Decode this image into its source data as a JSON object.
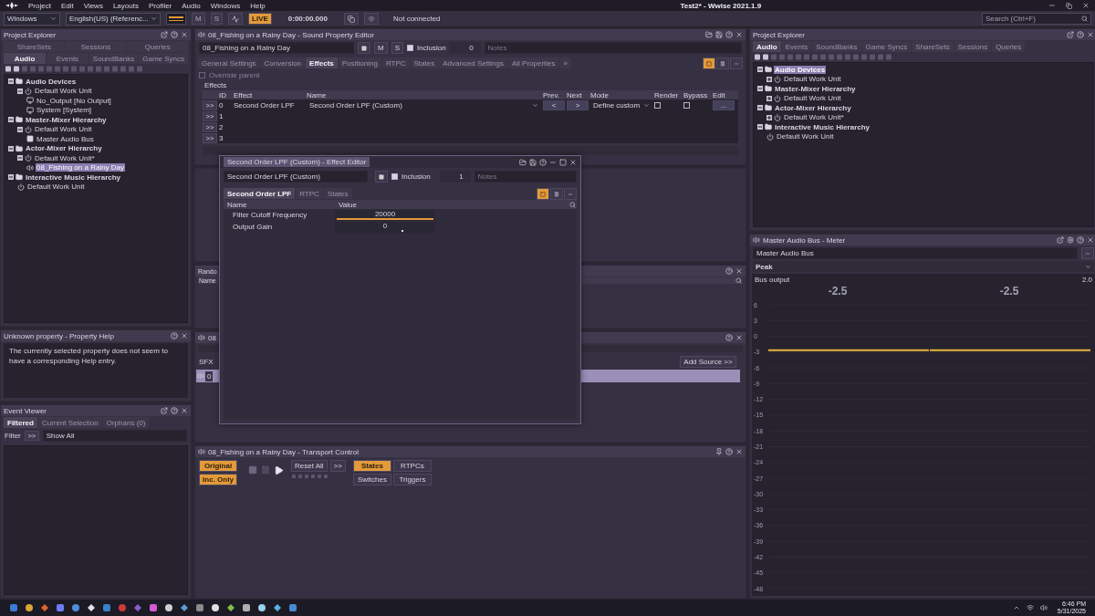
{
  "menu_bar": {
    "menus": [
      "Project",
      "Edit",
      "Views",
      "Layouts",
      "Profiler",
      "Audio",
      "Windows",
      "Help"
    ],
    "title": "Test2* - Wwise 2021.1.9"
  },
  "toolbar": {
    "platform": "Windows",
    "language": "English(US) (Referenc...",
    "mute": "M",
    "solo": "S",
    "live": "LIVE",
    "live_on": true,
    "time": "0:00:00.000",
    "status": "Not connected",
    "search": {
      "placeholder": "Search (Ctrl+F)"
    }
  },
  "left_explorer": {
    "title": "Project Explorer",
    "tab_rows": [
      [
        {
          "label": "ShareSets",
          "selected": false
        },
        {
          "label": "Sessions",
          "selected": false
        },
        {
          "label": "Queries",
          "selected": false
        }
      ],
      [
        {
          "label": "Audio",
          "selected": true
        },
        {
          "label": "Events",
          "selected": false
        },
        {
          "label": "SoundBanks",
          "selected": false
        },
        {
          "label": "Game Syncs",
          "selected": false
        }
      ]
    ],
    "tree": [
      {
        "label": "Audio Devices",
        "kind": "folder",
        "expanded": true,
        "selected": false,
        "children": [
          {
            "label": "Default Work Unit",
            "kind": "workunit",
            "expanded": true,
            "selected": false,
            "children": [
              {
                "label": "No_Output [No Output]",
                "kind": "device",
                "selected": false
              },
              {
                "label": "System [System]",
                "kind": "device",
                "selected": false
              }
            ]
          }
        ]
      },
      {
        "label": "Master-Mixer Hierarchy",
        "kind": "folder",
        "expanded": true,
        "selected": false,
        "children": [
          {
            "label": "Default Work Unit",
            "kind": "workunit",
            "expanded": true,
            "selected": false,
            "children": [
              {
                "label": "Master Audio Bus",
                "kind": "bus",
                "selected": false
              }
            ]
          }
        ]
      },
      {
        "label": "Actor-Mixer Hierarchy",
        "kind": "folder",
        "expanded": true,
        "selected": false,
        "children": [
          {
            "label": "Default Work Unit*",
            "kind": "workunit",
            "expanded": true,
            "selected": false,
            "children": [
              {
                "label": "08_Fishing on a Rainy Day",
                "kind": "sound",
                "selected": true
              }
            ]
          }
        ]
      },
      {
        "label": "Interactive Music Hierarchy",
        "kind": "folder",
        "expanded": true,
        "selected": false,
        "children": [
          {
            "label": "Default Work Unit",
            "kind": "workunit",
            "selected": false
          }
        ]
      }
    ]
  },
  "property_help": {
    "title": "Unknown property - Property Help",
    "text": "The currently selected property does not seem to have a corresponding Help entry."
  },
  "event_viewer": {
    "title": "Event Viewer",
    "tabs": [
      {
        "label": "Filtered",
        "selected": true
      },
      {
        "label": "Current Selection",
        "selected": false
      },
      {
        "label": "Orphans (0)",
        "selected": false
      }
    ],
    "filter_label": "Filter",
    "filter_button": ">>",
    "filter_value": "Show All"
  },
  "sound_editor": {
    "title": "08_Fishing on a Rainy Day - Sound Property Editor",
    "name": "08_Fishing on a Rainy Day",
    "mute": "M",
    "solo": "S",
    "inclusion": {
      "label": "Inclusion",
      "checked": true
    },
    "count": "0",
    "notes": {
      "placeholder": "Notes"
    },
    "tabs": [
      {
        "label": "General Settings",
        "selected": false
      },
      {
        "label": "Conversion",
        "selected": false
      },
      {
        "label": "Effects",
        "selected": true
      },
      {
        "label": "Positioning",
        "selected": false
      },
      {
        "label": "RTPC",
        "selected": false
      },
      {
        "label": "States",
        "selected": false
      },
      {
        "label": "Advanced Settings",
        "selected": false
      },
      {
        "label": "All Properties",
        "selected": false
      },
      {
        "label": "»",
        "selected": false
      }
    ],
    "override": {
      "label": "Override parent",
      "checked": false
    },
    "group": "Effects",
    "columns": [
      "ID",
      "Effect",
      "Name",
      "Prev.",
      "Next",
      "Mode",
      "Render",
      "Bypass",
      "Edit"
    ],
    "rows": [
      {
        "arrow": ">>",
        "id": "0",
        "effect": "Second Order LPF",
        "name": "Second Order LPF (Custom)",
        "prev": "<",
        "next": ">",
        "mode": "Define custom",
        "render": false,
        "bypass": false,
        "edit": "..."
      },
      {
        "arrow": ">>",
        "id": "1"
      },
      {
        "arrow": ">>",
        "id": "2"
      },
      {
        "arrow": ">>",
        "id": "3"
      }
    ]
  },
  "random_panel": {
    "title": "Rando",
    "column": "Name"
  },
  "contents_panel": {
    "title": "08",
    "section": "SFX",
    "add_button": "Add Source >>",
    "rows": [
      {
        "label": "0",
        "selected": true
      }
    ]
  },
  "transport": {
    "title": "08_Fishing on a Rainy Day - Transport Control",
    "toggles": [
      {
        "label": "Original",
        "on": true
      },
      {
        "label": "Inc. Only",
        "on": true
      }
    ],
    "reset": "Reset All",
    "more": ">>",
    "filters": [
      {
        "label": "States",
        "on": true
      },
      {
        "label": "RTPCs",
        "on": false
      },
      {
        "label": "Switches",
        "on": false
      },
      {
        "label": "Triggers",
        "on": false
      }
    ]
  },
  "effect_editor": {
    "title": "Second Order LPF (Custom) - Effect Editor",
    "name": "Second Order LPF (Custom)",
    "inclusion": {
      "label": "Inclusion",
      "checked": true
    },
    "count": "1",
    "notes": {
      "placeholder": "Notes"
    },
    "tabs": [
      {
        "label": "Second Order LPF",
        "selected": true
      },
      {
        "label": "RTPC",
        "selected": false
      },
      {
        "label": "States",
        "selected": false
      }
    ],
    "columns": [
      "Name",
      "Value"
    ],
    "properties": [
      {
        "name": "Filter Cutoff Frequency",
        "value": "20000",
        "kind": "fill",
        "level": 1
      },
      {
        "name": "Output Gain",
        "value": "0",
        "kind": "thumb",
        "level": 0.67
      }
    ]
  },
  "right_explorer": {
    "title": "Project Explorer",
    "tabs": [
      {
        "label": "Audio",
        "selected": true
      },
      {
        "label": "Events",
        "selected": false
      },
      {
        "label": "SoundBanks",
        "selected": false
      },
      {
        "label": "Game Syncs",
        "selected": false
      },
      {
        "label": "ShareSets",
        "selected": false
      },
      {
        "label": "Sessions",
        "selected": false
      },
      {
        "label": "Queries",
        "selected": false
      }
    ],
    "tree": [
      {
        "label": "Audio Devices",
        "kind": "folder",
        "expanded": true,
        "selected": true,
        "children": [
          {
            "label": "Default Work Unit",
            "kind": "workunit",
            "expanded": false,
            "selected": false
          }
        ]
      },
      {
        "label": "Master-Mixer Hierarchy",
        "kind": "folder",
        "expanded": true,
        "selected": false,
        "children": [
          {
            "label": "Default Work Unit",
            "kind": "workunit",
            "expanded": false,
            "selected": false
          }
        ]
      },
      {
        "label": "Actor-Mixer Hierarchy",
        "kind": "folder",
        "expanded": true,
        "selected": false,
        "children": [
          {
            "label": "Default Work Unit*",
            "kind": "workunit",
            "expanded": false,
            "selected": false
          }
        ]
      },
      {
        "label": "Interactive Music Hierarchy",
        "kind": "folder",
        "expanded": true,
        "selected": false,
        "children": [
          {
            "label": "Default Work Unit",
            "kind": "workunit",
            "selected": false
          }
        ]
      }
    ]
  },
  "meter": {
    "title": "Master Audio Bus - Meter",
    "bus": "Master Audio Bus",
    "mode": "Peak",
    "label": "Bus output",
    "max": "2.0",
    "channels": [
      {
        "reading": "-2.5"
      },
      {
        "reading": "-2.5"
      }
    ],
    "scale": [
      "6",
      "3",
      "0",
      "-3",
      "-6",
      "-9",
      "-12",
      "-15",
      "-18",
      "-21",
      "-24",
      "-27",
      "-30",
      "-33",
      "-36",
      "-39",
      "-42",
      "-45",
      "-48"
    ]
  },
  "taskbar": {
    "time": "6:46 PM",
    "date": "5/31/2025"
  }
}
